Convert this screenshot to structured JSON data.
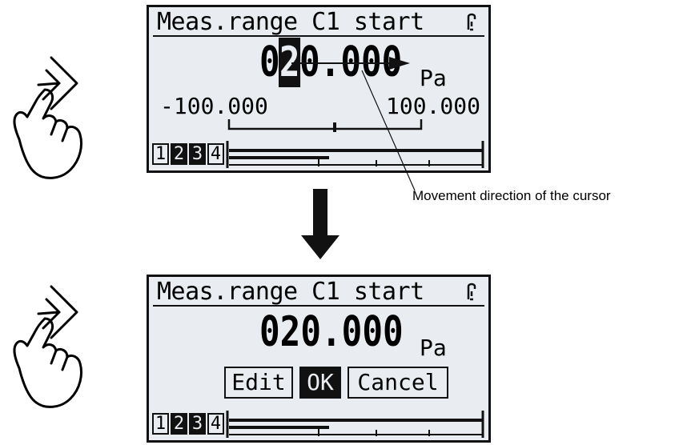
{
  "top_screen": {
    "title": "Meas.range C1 start",
    "value_prefix": "0",
    "value_cursor_digit": "2",
    "value_rest": "0.000",
    "unit": "Pa",
    "range_min": "-100.000",
    "range_max": "100.000",
    "channels": [
      "1",
      "2",
      "3",
      "4"
    ]
  },
  "bottom_screen": {
    "title": "Meas.range C1 start",
    "value": "020.000",
    "unit": "Pa",
    "buttons": {
      "edit": "Edit",
      "ok": "OK",
      "cancel": "Cancel"
    },
    "channels": [
      "1",
      "2",
      "3",
      "4"
    ]
  },
  "annotation": {
    "caption": "Movement direction of the cursor"
  },
  "icons": {
    "hand": "hand-swipe-right-icon",
    "lock": "lock-icon",
    "arrow": "down-arrow-icon"
  }
}
